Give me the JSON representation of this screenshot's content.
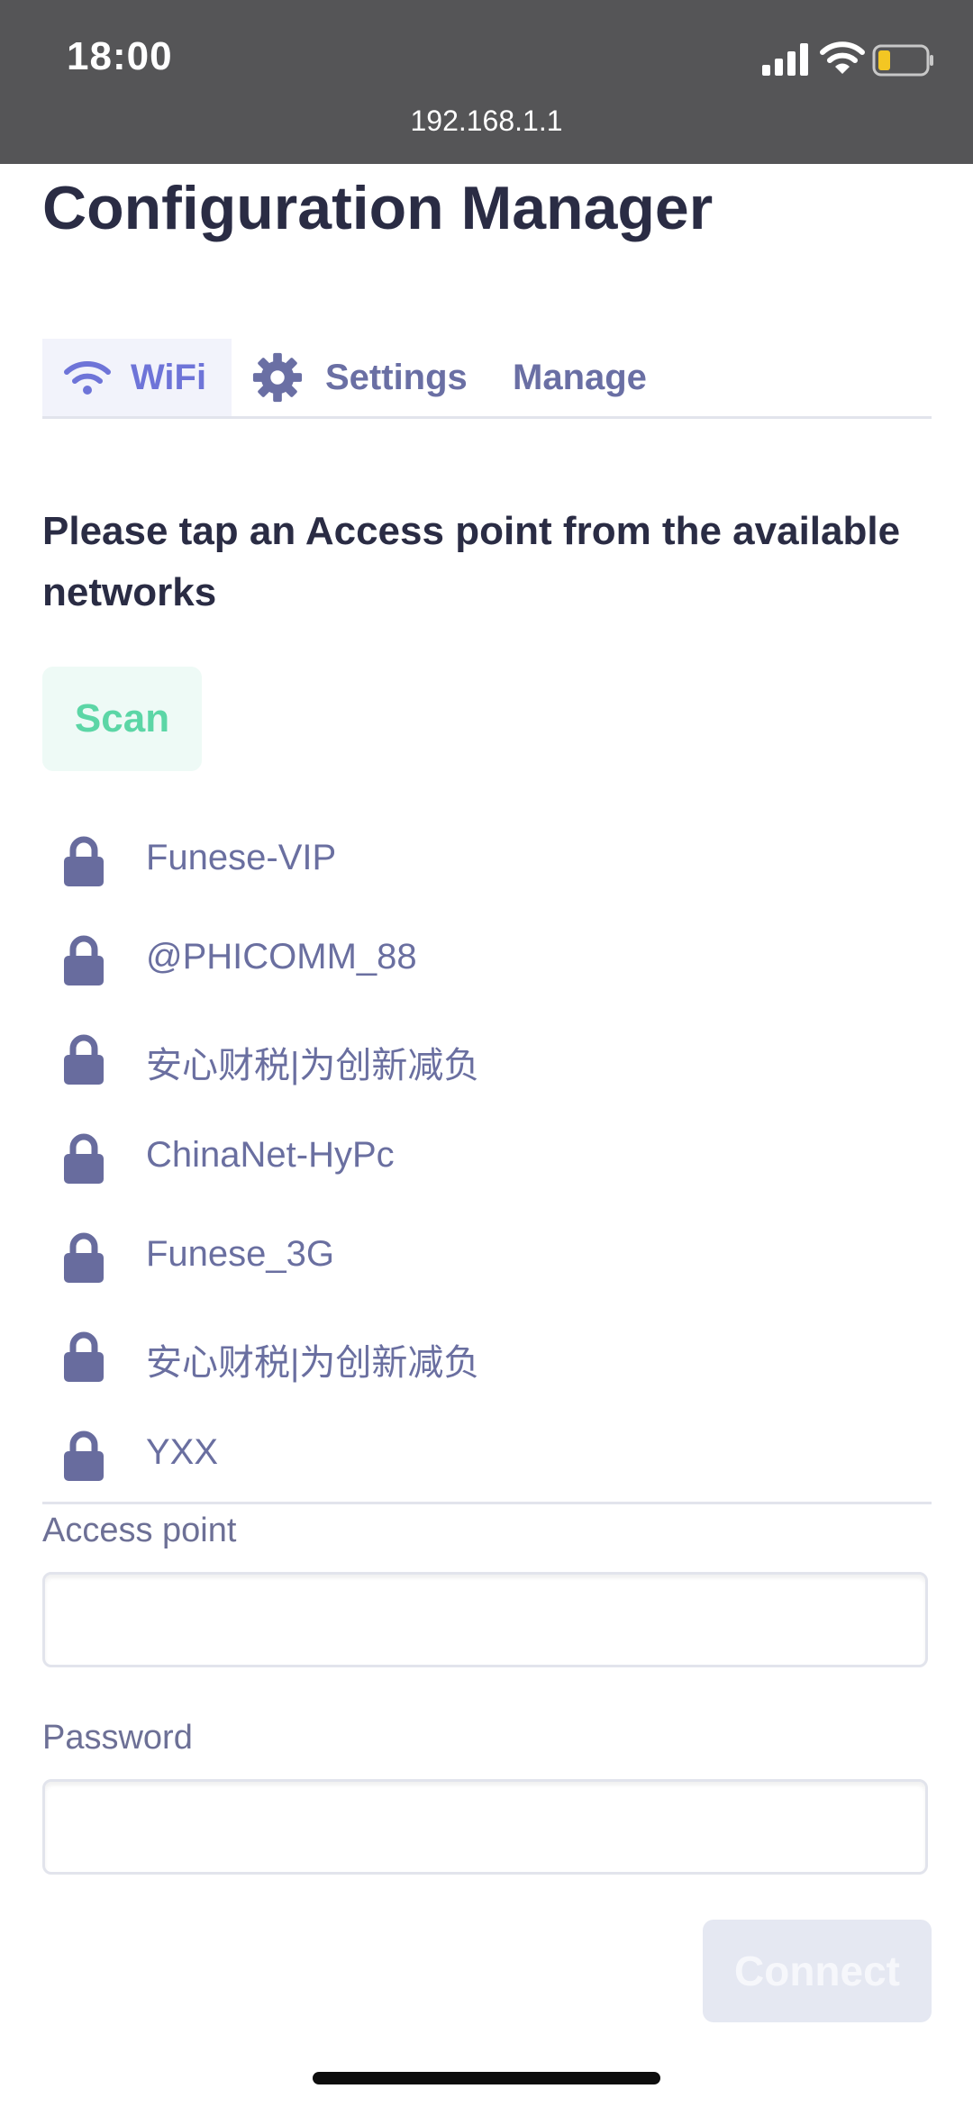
{
  "status_bar": {
    "time": "18:00",
    "url": "192.168.1.1"
  },
  "page": {
    "title": "Configuration Manager"
  },
  "tabs": [
    {
      "label": "WiFi",
      "icon": "wifi-icon",
      "active": true
    },
    {
      "label": "Settings",
      "icon": "gear-icon",
      "active": false
    },
    {
      "label": "Manage",
      "active": false
    }
  ],
  "instructions": "Please tap an Access point from the available networks",
  "scan_label": "Scan",
  "networks": [
    {
      "name": "Funese-VIP",
      "icon": "lock-icon"
    },
    {
      "name": "@PHICOMM_88",
      "icon": "lock-icon"
    },
    {
      "name": "安心财税|为创新减负",
      "icon": "lock-icon"
    },
    {
      "name": "ChinaNet-HyPc",
      "icon": "lock-icon"
    },
    {
      "name": "Funese_3G",
      "icon": "lock-icon"
    },
    {
      "name": "安心财税|为创新减负",
      "icon": "lock-icon"
    },
    {
      "name": "YXX",
      "icon": "lock-icon"
    }
  ],
  "form": {
    "access_point_label": "Access point",
    "access_point_value": "",
    "password_label": "Password",
    "password_value": "",
    "connect_label": "Connect"
  },
  "colors": {
    "accent": "#6e74d8",
    "scan_text": "#5cd6a6",
    "network_text": "#6a6fa0",
    "status_bar_bg": "#555557",
    "battery_level": "#f3c623"
  }
}
